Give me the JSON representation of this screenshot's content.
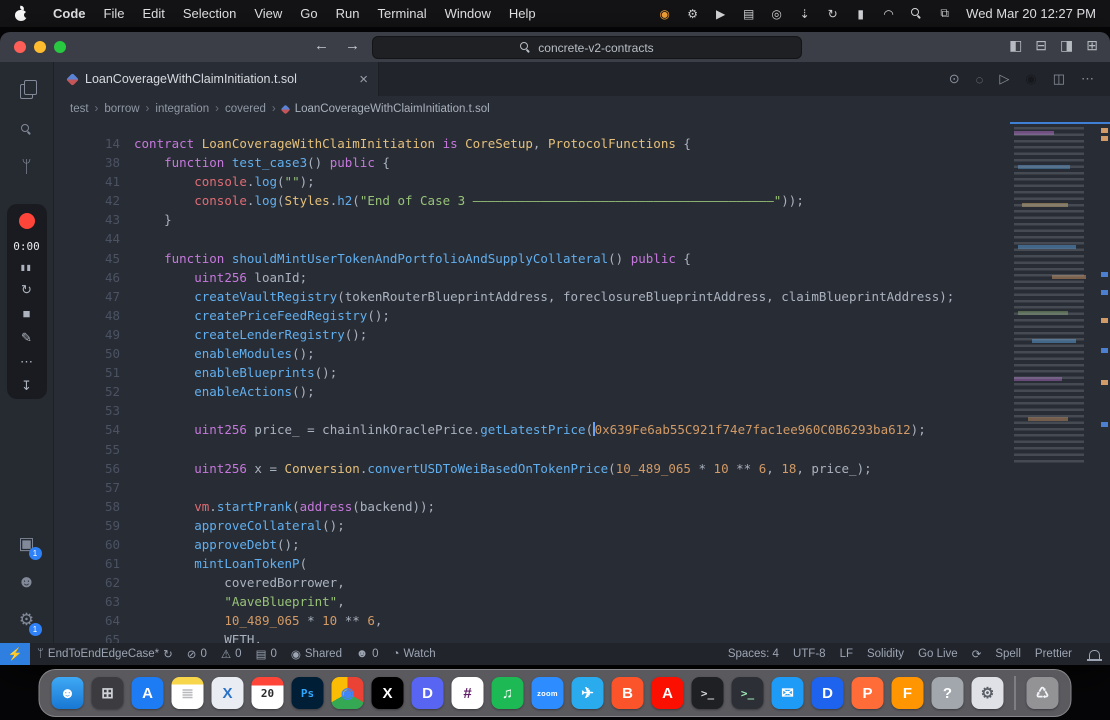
{
  "menubar": {
    "app_name": "Code",
    "menus": [
      "File",
      "Edit",
      "Selection",
      "View",
      "Go",
      "Run",
      "Terminal",
      "Window",
      "Help"
    ],
    "status_icons": [
      {
        "name": "recorder-status-icon",
        "glyph": "◉",
        "color": "#f6a33a"
      },
      {
        "name": "gear-status-icon",
        "glyph": "⚙"
      },
      {
        "name": "play-status-icon",
        "glyph": "▶"
      },
      {
        "name": "stats-status-icon",
        "glyph": "▤"
      },
      {
        "name": "camera-status-icon",
        "glyph": "◎"
      },
      {
        "name": "download-status-icon",
        "glyph": "⇣"
      },
      {
        "name": "sync-status-icon",
        "glyph": "↻"
      },
      {
        "name": "battery-icon",
        "glyph": "▮"
      },
      {
        "name": "wifi-icon",
        "glyph": "◠"
      },
      {
        "name": "spotlight-search-icon",
        "glyph": "mag"
      },
      {
        "name": "control-center-icon",
        "glyph": "⧉"
      }
    ],
    "clock": "Wed Mar 20 12:27 PM"
  },
  "titlebar": {
    "search_value": "concrete-v2-contracts",
    "layout_icons": [
      {
        "name": "toggle-sidebar-icon",
        "glyph": "◧"
      },
      {
        "name": "toggle-panel-icon",
        "glyph": "⊟"
      },
      {
        "name": "toggle-secondary-sidebar-icon",
        "glyph": "◨"
      },
      {
        "name": "customize-layout-icon",
        "glyph": "⊞"
      }
    ]
  },
  "tabbar": {
    "tab_title": "LoanCoverageWithClaimInitiation.t.sol",
    "close_glyph": "×",
    "action_icons": [
      {
        "name": "run-previous-icon",
        "glyph": "⊙"
      },
      {
        "name": "outline-icon",
        "glyph": "◌"
      },
      {
        "name": "run-icon",
        "glyph": "▷"
      },
      {
        "name": "debug-profile-icon",
        "glyph": "◉",
        "color": "#16181d"
      },
      {
        "name": "split-editor-icon",
        "glyph": "◫"
      },
      {
        "name": "more-actions-icon",
        "glyph": "⋯"
      }
    ]
  },
  "breadcrumbs": {
    "path": [
      "test",
      "borrow",
      "integration",
      "covered"
    ],
    "file": "LoanCoverageWithClaimInitiation.t.sol",
    "separator": "›"
  },
  "activitybar": {
    "top": [
      {
        "name": "explorer-icon",
        "glyph": "files"
      },
      {
        "name": "search-icon",
        "glyph": "mag"
      },
      {
        "name": "source-control-icon",
        "glyph": "ᛘ"
      }
    ],
    "recorder": {
      "time": "0:00",
      "pause_glyph": "▮▮",
      "restart_glyph": "↻",
      "stop_glyph": "■",
      "draw_glyph": "✎",
      "more_glyph": "⋯",
      "share_glyph": "↧"
    },
    "bottom": [
      {
        "name": "screen-share-icon",
        "glyph": "▣",
        "badge": "1"
      },
      {
        "name": "account-icon",
        "glyph": "☻"
      },
      {
        "name": "settings-gear-icon",
        "glyph": "⚙",
        "badge": "1"
      }
    ]
  },
  "code": {
    "lines": [
      {
        "n": "14",
        "t": [
          [
            "contract ",
            "k"
          ],
          [
            "LoanCoverageWithClaimInitiation",
            "t"
          ],
          [
            " ",
            "p"
          ],
          [
            "is",
            "k"
          ],
          [
            " ",
            "p"
          ],
          [
            "CoreSetup",
            "t"
          ],
          [
            ", ",
            "p"
          ],
          [
            "ProtocolFunctions",
            "t"
          ],
          [
            " {",
            "p"
          ]
        ]
      },
      {
        "n": "38",
        "t": [
          [
            "    ",
            "p"
          ],
          [
            "function ",
            "k"
          ],
          [
            "test_case3",
            "f"
          ],
          [
            "() ",
            "p"
          ],
          [
            "public",
            "k"
          ],
          [
            " {",
            "p"
          ]
        ]
      },
      {
        "n": "41",
        "t": [
          [
            "        ",
            "p"
          ],
          [
            "console",
            "v"
          ],
          [
            ".",
            "p"
          ],
          [
            "log",
            "f"
          ],
          [
            "(",
            "p"
          ],
          [
            "\"\"",
            "s"
          ],
          [
            ");",
            "p"
          ]
        ]
      },
      {
        "n": "42",
        "t": [
          [
            "        ",
            "p"
          ],
          [
            "console",
            "v"
          ],
          [
            ".",
            "p"
          ],
          [
            "log",
            "f"
          ],
          [
            "(",
            "p"
          ],
          [
            "Styles",
            "t"
          ],
          [
            ".",
            "p"
          ],
          [
            "h2",
            "f"
          ],
          [
            "(",
            "p"
          ],
          [
            "\"End of Case 3 ————————————————————————————————————————\"",
            "s"
          ],
          [
            "));",
            "p"
          ]
        ]
      },
      {
        "n": "43",
        "t": [
          [
            "    }",
            "p"
          ]
        ]
      },
      {
        "n": "44",
        "t": []
      },
      {
        "n": "45",
        "t": [
          [
            "    ",
            "p"
          ],
          [
            "function ",
            "k"
          ],
          [
            "shouldMintUserTokenAndPortfolioAndSupplyCollateral",
            "f"
          ],
          [
            "() ",
            "p"
          ],
          [
            "public",
            "k"
          ],
          [
            " {",
            "p"
          ]
        ]
      },
      {
        "n": "46",
        "t": [
          [
            "        ",
            "p"
          ],
          [
            "uint256",
            "k"
          ],
          [
            " loanId;",
            "p"
          ]
        ]
      },
      {
        "n": "47",
        "t": [
          [
            "        ",
            "p"
          ],
          [
            "createVaultRegistry",
            "f"
          ],
          [
            "(tokenRouterBlueprintAddress, foreclosureBlueprintAddress, claimBlueprintAddress);",
            "p"
          ]
        ]
      },
      {
        "n": "48",
        "t": [
          [
            "        ",
            "p"
          ],
          [
            "createPriceFeedRegistry",
            "f"
          ],
          [
            "();",
            "p"
          ]
        ]
      },
      {
        "n": "49",
        "t": [
          [
            "        ",
            "p"
          ],
          [
            "createLenderRegistry",
            "f"
          ],
          [
            "();",
            "p"
          ]
        ]
      },
      {
        "n": "50",
        "t": [
          [
            "        ",
            "p"
          ],
          [
            "enableModules",
            "f"
          ],
          [
            "();",
            "p"
          ]
        ]
      },
      {
        "n": "51",
        "t": [
          [
            "        ",
            "p"
          ],
          [
            "enableBlueprints",
            "f"
          ],
          [
            "();",
            "p"
          ]
        ]
      },
      {
        "n": "52",
        "t": [
          [
            "        ",
            "p"
          ],
          [
            "enableActions",
            "f"
          ],
          [
            "();",
            "p"
          ]
        ]
      },
      {
        "n": "53",
        "t": []
      },
      {
        "n": "54",
        "t": [
          [
            "        ",
            "p"
          ],
          [
            "uint256",
            "k"
          ],
          [
            " price_ = chainlinkOraclePrice.",
            "p"
          ],
          [
            "getLatestPrice",
            "f"
          ],
          [
            "(",
            "p"
          ],
          [
            "",
            "c"
          ],
          [
            "0x639Fe6ab55C921f74e7fac1ee960C0B6293ba612",
            "n"
          ],
          [
            ");",
            "p"
          ]
        ]
      },
      {
        "n": "55",
        "t": []
      },
      {
        "n": "56",
        "t": [
          [
            "        ",
            "p"
          ],
          [
            "uint256",
            "k"
          ],
          [
            " x = ",
            "p"
          ],
          [
            "Conversion",
            "t"
          ],
          [
            ".",
            "p"
          ],
          [
            "convertUSDToWeiBasedOnTokenPrice",
            "f"
          ],
          [
            "(",
            "p"
          ],
          [
            "10_489_065",
            "n"
          ],
          [
            " * ",
            "p"
          ],
          [
            "10",
            "n"
          ],
          [
            " ** ",
            "p"
          ],
          [
            "6",
            "n"
          ],
          [
            ", ",
            "p"
          ],
          [
            "18",
            "n"
          ],
          [
            ", price_);",
            "p"
          ]
        ]
      },
      {
        "n": "57",
        "t": []
      },
      {
        "n": "58",
        "t": [
          [
            "        ",
            "p"
          ],
          [
            "vm",
            "v"
          ],
          [
            ".",
            "p"
          ],
          [
            "startPrank",
            "f"
          ],
          [
            "(",
            "p"
          ],
          [
            "address",
            "k"
          ],
          [
            "(backend));",
            "p"
          ]
        ]
      },
      {
        "n": "59",
        "t": [
          [
            "        ",
            "p"
          ],
          [
            "approveCollateral",
            "f"
          ],
          [
            "();",
            "p"
          ]
        ]
      },
      {
        "n": "60",
        "t": [
          [
            "        ",
            "p"
          ],
          [
            "approveDebt",
            "f"
          ],
          [
            "();",
            "p"
          ]
        ]
      },
      {
        "n": "61",
        "t": [
          [
            "        ",
            "p"
          ],
          [
            "mintLoanTokenP",
            "f"
          ],
          [
            "(",
            "p"
          ]
        ]
      },
      {
        "n": "62",
        "t": [
          [
            "            coveredBorrower,",
            "p"
          ]
        ]
      },
      {
        "n": "63",
        "t": [
          [
            "            ",
            "p"
          ],
          [
            "\"AaveBlueprint\"",
            "s"
          ],
          [
            ",",
            "p"
          ]
        ]
      },
      {
        "n": "64",
        "t": [
          [
            "            ",
            "p"
          ],
          [
            "10_489_065",
            "n"
          ],
          [
            " * ",
            "p"
          ],
          [
            "10",
            "n"
          ],
          [
            " ** ",
            "p"
          ],
          [
            "6",
            "n"
          ],
          [
            ",",
            "p"
          ]
        ]
      },
      {
        "n": "65",
        "t": [
          [
            "            WETH,",
            "p"
          ]
        ]
      }
    ]
  },
  "statusbar": {
    "remote_glyph": "⚡",
    "branch": {
      "glyph": "ᛘ",
      "label": "EndToEndEdgeCase*",
      "sync_glyph": "↻"
    },
    "left_items": [
      {
        "name": "errors-count",
        "glyph": "⊘",
        "label": "0"
      },
      {
        "name": "warnings-count",
        "glyph": "⚠",
        "label": "0"
      },
      {
        "name": "ports-count",
        "glyph": "▤",
        "label": "0"
      },
      {
        "name": "shared-indicator",
        "glyph": "◉",
        "label": "Shared"
      },
      {
        "name": "clients-count",
        "glyph": "☻",
        "label": "0"
      },
      {
        "name": "watch-indicator",
        "glyph": "◔",
        "label": "Watch"
      }
    ],
    "right_items": [
      {
        "name": "indent-indicator",
        "label": "Spaces: 4"
      },
      {
        "name": "encoding-indicator",
        "label": "UTF-8"
      },
      {
        "name": "eol-indicator",
        "label": "LF"
      },
      {
        "name": "language-indicator",
        "label": "Solidity"
      },
      {
        "name": "go-live-button",
        "label": "Go Live"
      },
      {
        "name": "spinner-indicator",
        "label": "⟳"
      },
      {
        "name": "spell-checker",
        "label": "Spell"
      },
      {
        "name": "prettier-indicator",
        "label": "Prettier"
      }
    ]
  },
  "dock": {
    "apps": [
      {
        "name": "finder",
        "glyph": "☻",
        "bg": "linear-gradient(180deg,#3fa9f5,#1877d2)",
        "fg": "#ffffff"
      },
      {
        "name": "launchpad",
        "glyph": "⊞",
        "bg": "#3b3b40",
        "fg": "#cfd2d8"
      },
      {
        "name": "app-store",
        "glyph": "A",
        "bg": "#1d7bf3",
        "fg": "#ffffff"
      },
      {
        "name": "notes",
        "glyph": "≣",
        "bg": "linear-gradient(180deg,#f7d64b 0%,#f7d64b 24%,#ffffff 24%)",
        "fg": "#b9b9bd"
      },
      {
        "name": "xcode",
        "glyph": "X",
        "bg": "#e9ecf2",
        "fg": "#2a72c8"
      },
      {
        "name": "calendar",
        "glyph": "20",
        "bg": "linear-gradient(180deg,#ff4538 0%,#ff4538 27%,#ffffff 27%)",
        "fg": "#2b2b2e"
      },
      {
        "name": "photoshop",
        "glyph": "Ps",
        "bg": "#001e36",
        "fg": "#31a8ff"
      },
      {
        "name": "chrome",
        "glyph": "◉",
        "bg": "conic-gradient(#ea4335 0 120deg,#34a853 0 240deg,#fbbc05 0 360deg)",
        "fg": "#4285f4"
      },
      {
        "name": "x-app",
        "glyph": "X",
        "bg": "#000000",
        "fg": "#ffffff"
      },
      {
        "name": "discord",
        "glyph": "D",
        "bg": "#5865f2",
        "fg": "#ffffff"
      },
      {
        "name": "slack",
        "glyph": "#",
        "bg": "#ffffff",
        "fg": "#611f69"
      },
      {
        "name": "spotify",
        "glyph": "♫",
        "bg": "#1db954",
        "fg": "#ffffff"
      },
      {
        "name": "zoom",
        "glyph": "zoom",
        "bg": "#2d8cff",
        "fg": "#ffffff"
      },
      {
        "name": "telegram",
        "glyph": "✈",
        "bg": "#2aabee",
        "fg": "#ffffff"
      },
      {
        "name": "brave",
        "glyph": "B",
        "bg": "#fb542b",
        "fg": "#ffffff"
      },
      {
        "name": "acrobat",
        "glyph": "A",
        "bg": "#fa0f00",
        "fg": "#ffffff"
      },
      {
        "name": "terminal",
        "glyph": ">_",
        "bg": "#1f2023",
        "fg": "#d6d8dd"
      },
      {
        "name": "iterm",
        "glyph": ">_",
        "bg": "#2c2f36",
        "fg": "#9fe8b8"
      },
      {
        "name": "mail",
        "glyph": "✉",
        "bg": "#1d9bf6",
        "fg": "#ffffff"
      },
      {
        "name": "docker",
        "glyph": "D",
        "bg": "#1d63ed",
        "fg": "#ffffff"
      },
      {
        "name": "postman",
        "glyph": "P",
        "bg": "#ff6c37",
        "fg": "#ffffff"
      },
      {
        "name": "firefox",
        "glyph": "F",
        "bg": "#ff9500",
        "fg": "#ffffff"
      },
      {
        "name": "help",
        "glyph": "?",
        "bg": "#a2a7ae",
        "fg": "#ffffff"
      },
      {
        "name": "system-settings",
        "glyph": "⚙",
        "bg": "#dfe1e6",
        "fg": "#5b5e66"
      },
      {
        "divider": true
      },
      {
        "name": "trash",
        "glyph": "♺",
        "bg": "rgba(255,255,255,0.35)",
        "fg": "#f2f4f8"
      }
    ]
  },
  "palette": {
    "editor_bg": "#282c34",
    "keyword": "#c678dd",
    "type": "#e5c07b",
    "function": "#61afef",
    "string": "#98c379",
    "number": "#d19a66",
    "variable": "#e06c75",
    "accent_blue": "#2f7fe0",
    "record_red": "#ff453a"
  }
}
